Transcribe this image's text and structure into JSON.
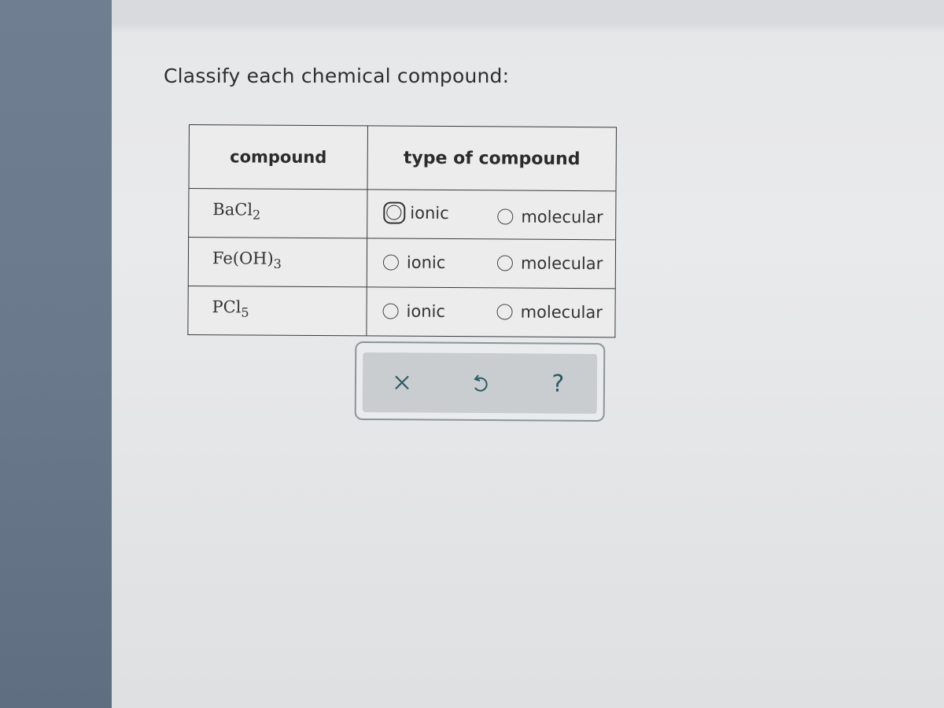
{
  "prompt": "Classify each chemical compound:",
  "table": {
    "headers": {
      "compound": "compound",
      "type": "type of compound"
    },
    "rows": [
      {
        "formula_base": "BaCl",
        "formula_sub": "2",
        "formula_suffix": "",
        "options": [
          "ionic",
          "molecular"
        ],
        "focused": "ionic",
        "selected": null
      },
      {
        "formula_base": "Fe(OH)",
        "formula_sub": "3",
        "formula_suffix": "",
        "options": [
          "ionic",
          "molecular"
        ],
        "focused": null,
        "selected": null
      },
      {
        "formula_base": "PCl",
        "formula_sub": "5",
        "formula_suffix": "",
        "options": [
          "ionic",
          "molecular"
        ],
        "focused": null,
        "selected": null
      }
    ]
  },
  "toolbar": {
    "buttons": [
      {
        "name": "clear",
        "icon": "x-icon"
      },
      {
        "name": "undo",
        "icon": "undo-icon"
      },
      {
        "name": "help",
        "icon": "question-icon",
        "glyph": "?"
      }
    ]
  },
  "colors": {
    "icon": "#2e5a66",
    "sidebar": "#6a7a8c"
  }
}
